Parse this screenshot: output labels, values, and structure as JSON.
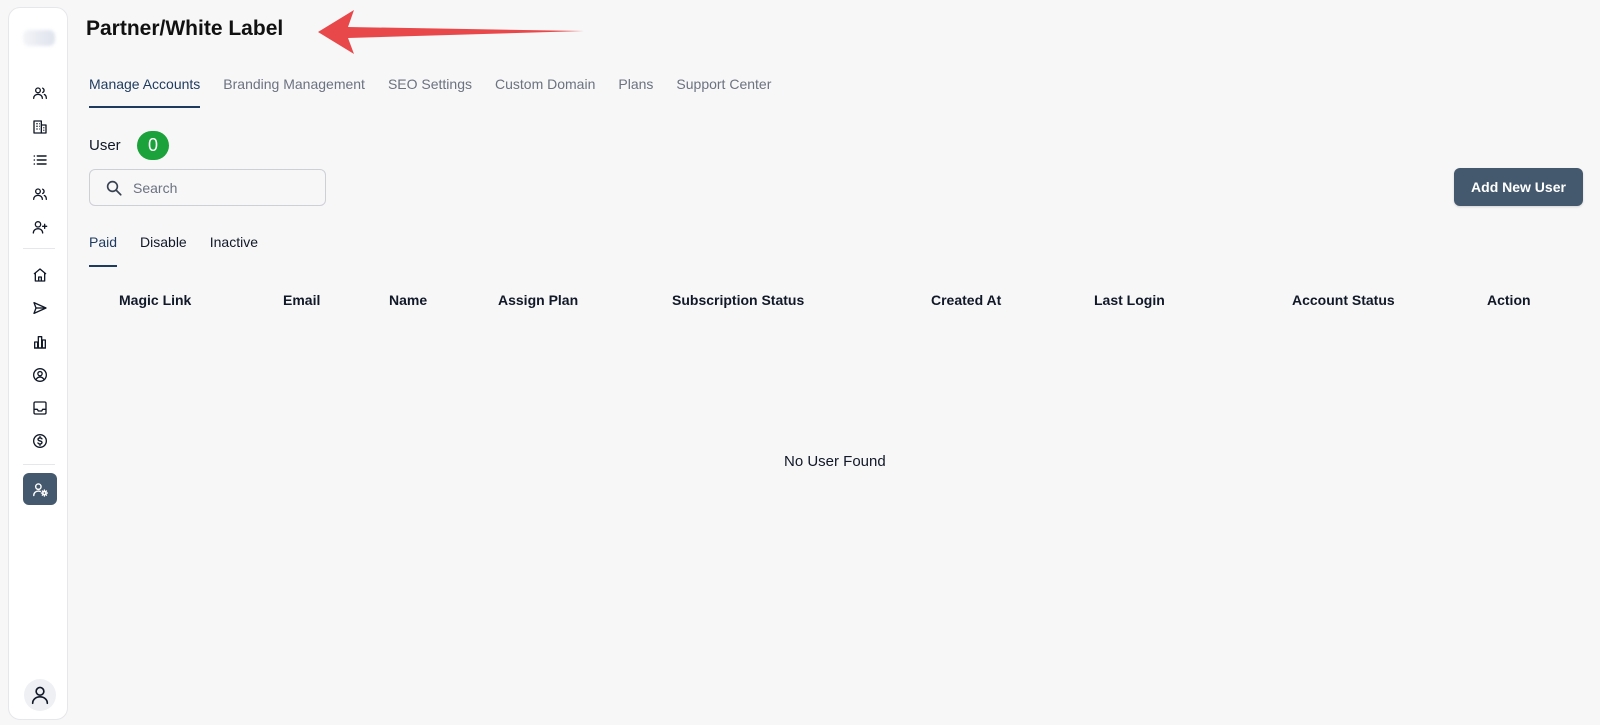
{
  "page": {
    "title": "Partner/White Label"
  },
  "tabs": [
    {
      "label": "Manage Accounts",
      "active": true
    },
    {
      "label": "Branding Management"
    },
    {
      "label": "SEO Settings"
    },
    {
      "label": "Custom Domain"
    },
    {
      "label": "Plans"
    },
    {
      "label": "Support Center"
    }
  ],
  "user_count": {
    "label": "User",
    "count": "0",
    "badge_color": "#1ba23a"
  },
  "search": {
    "placeholder": "Search"
  },
  "add_button": {
    "label": "Add New User",
    "color": "#44596e"
  },
  "subtabs": [
    {
      "label": "Paid",
      "active": true
    },
    {
      "label": "Disable"
    },
    {
      "label": "Inactive"
    }
  ],
  "table": {
    "columns": [
      "Magic Link",
      "Email",
      "Name",
      "Assign Plan",
      "Subscription Status",
      "Created At",
      "Last Login",
      "Account Status",
      "Action"
    ],
    "empty_message": "No User Found"
  },
  "sidebar": {
    "icons": [
      "users-icon",
      "building-icon",
      "list-icon",
      "users-icon",
      "user-plus-icon",
      "home-icon",
      "send-icon",
      "bar-chart-icon",
      "user-circle-icon",
      "inbox-icon",
      "dollar-circle-icon"
    ],
    "active_icon": "user-gear-icon",
    "avatar_icon": "user-icon"
  },
  "colors": {
    "accent": "#1e3a5f",
    "annotation_arrow": "#e8484a"
  }
}
